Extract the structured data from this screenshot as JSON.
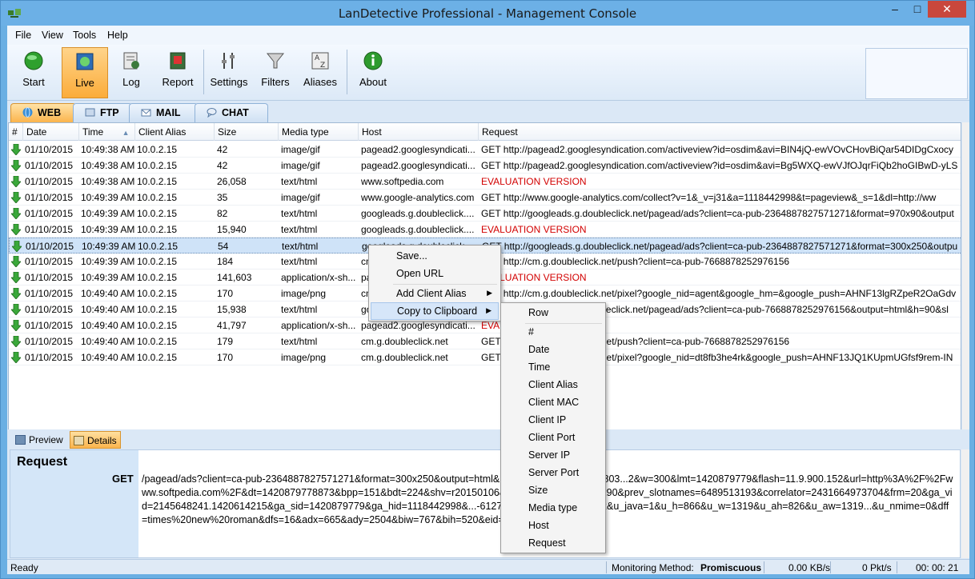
{
  "window": {
    "title": "LanDetective Professional - Management Console"
  },
  "menu": [
    "File",
    "View",
    "Tools",
    "Help"
  ],
  "toolbar": {
    "buttons": [
      {
        "label": "Start",
        "icon": "start-icon"
      },
      {
        "label": "Live",
        "icon": "live-icon",
        "active": true
      },
      {
        "label": "Log",
        "icon": "log-icon"
      },
      {
        "label": "Report",
        "icon": "report-icon"
      },
      {
        "label": "Settings",
        "icon": "settings-icon"
      },
      {
        "label": "Filters",
        "icon": "filter-icon"
      },
      {
        "label": "Aliases",
        "icon": "aliases-icon"
      },
      {
        "label": "About",
        "icon": "info-icon"
      }
    ]
  },
  "tabs": [
    {
      "label": "WEB",
      "active": true
    },
    {
      "label": "FTP"
    },
    {
      "label": "MAIL"
    },
    {
      "label": "CHAT"
    }
  ],
  "grid": {
    "columns": [
      "#",
      "Date",
      "Time",
      "Client Alias",
      "Size",
      "Media type",
      "Host",
      "Request"
    ],
    "rows": [
      {
        "date": "01/10/2015",
        "time": "10:49:38 AM",
        "client": "10.0.2.15",
        "size": "42",
        "media": "image/gif",
        "host": "pagead2.googlesyndicati...",
        "request": "GET http://pagead2.googlesyndication.com/activeview?id=osdim&avi=BIN4jQ-ewVOvCHovBiQar54DIDgCxocy",
        "eval": false
      },
      {
        "date": "01/10/2015",
        "time": "10:49:38 AM",
        "client": "10.0.2.15",
        "size": "42",
        "media": "image/gif",
        "host": "pagead2.googlesyndicati...",
        "request": "GET http://pagead2.googlesyndication.com/activeview?id=osdim&avi=Bg5WXQ-ewVJfOJqrFiQb2hoGIBwD-yLS",
        "eval": false
      },
      {
        "date": "01/10/2015",
        "time": "10:49:38 AM",
        "client": "10.0.2.15",
        "size": "26,058",
        "media": "text/html",
        "host": "www.softpedia.com",
        "request": "EVALUATION VERSION",
        "eval": true
      },
      {
        "date": "01/10/2015",
        "time": "10:49:39 AM",
        "client": "10.0.2.15",
        "size": "35",
        "media": "image/gif",
        "host": "www.google-analytics.com",
        "request": "GET http://www.google-analytics.com/collect?v=1&_v=j31&a=1118442998&t=pageview&_s=1&dl=http://ww",
        "eval": false
      },
      {
        "date": "01/10/2015",
        "time": "10:49:39 AM",
        "client": "10.0.2.15",
        "size": "82",
        "media": "text/html",
        "host": "googleads.g.doubleclick....",
        "request": "GET http://googleads.g.doubleclick.net/pagead/ads?client=ca-pub-2364887827571271&format=970x90&output",
        "eval": false
      },
      {
        "date": "01/10/2015",
        "time": "10:49:39 AM",
        "client": "10.0.2.15",
        "size": "15,940",
        "media": "text/html",
        "host": "googleads.g.doubleclick....",
        "request": "EVALUATION VERSION",
        "eval": true
      },
      {
        "date": "01/10/2015",
        "time": "10:49:39 AM",
        "client": "10.0.2.15",
        "size": "54",
        "media": "text/html",
        "host": "googleads.g.doubleclick....",
        "request": "GET http://googleads.g.doubleclick.net/pagead/ads?client=ca-pub-2364887827571271&format=300x250&outpu",
        "eval": false,
        "selected": true
      },
      {
        "date": "01/10/2015",
        "time": "10:49:39 AM",
        "client": "10.0.2.15",
        "size": "184",
        "media": "text/html",
        "host": "cm.g.doubleclick.net",
        "request": "GET http://cm.g.doubleclick.net/push?client=ca-pub-7668878252976156",
        "eval": false
      },
      {
        "date": "01/10/2015",
        "time": "10:49:39 AM",
        "client": "10.0.2.15",
        "size": "141,603",
        "media": "application/x-sh...",
        "host": "pagead2.googlesyndicati...",
        "request": "EVALUATION VERSION",
        "eval": true
      },
      {
        "date": "01/10/2015",
        "time": "10:49:40 AM",
        "client": "10.0.2.15",
        "size": "170",
        "media": "image/png",
        "host": "cm.g.doubleclick.net",
        "request": "GET http://cm.g.doubleclick.net/pixel?google_nid=agent&google_hm=&google_push=AHNF13lgRZpeR2OaGdv",
        "eval": false
      },
      {
        "date": "01/10/2015",
        "time": "10:49:40 AM",
        "client": "10.0.2.15",
        "size": "15,938",
        "media": "text/html",
        "host": "googleads.g.doubleclick....",
        "request": "GET http://googleads.g.doubleclick.net/pagead/ads?client=ca-pub-7668878252976156&output=html&h=90&sl",
        "eval": false
      },
      {
        "date": "01/10/2015",
        "time": "10:49:40 AM",
        "client": "10.0.2.15",
        "size": "41,797",
        "media": "application/x-sh...",
        "host": "pagead2.googlesyndicati...",
        "request": "EVALUATION VERSION",
        "eval": true
      },
      {
        "date": "01/10/2015",
        "time": "10:49:40 AM",
        "client": "10.0.2.15",
        "size": "179",
        "media": "text/html",
        "host": "cm.g.doubleclick.net",
        "request": "GET http://cm.g.doubleclick.net/push?client=ca-pub-7668878252976156",
        "eval": false
      },
      {
        "date": "01/10/2015",
        "time": "10:49:40 AM",
        "client": "10.0.2.15",
        "size": "170",
        "media": "image/png",
        "host": "cm.g.doubleclick.net",
        "request": "GET http://cm.g.doubleclick.net/pixel?google_nid=dt8fb3he4rk&google_push=AHNF13JQ1KUpmUGfsf9rem-IN",
        "eval": false
      }
    ]
  },
  "bottom_tabs": [
    {
      "label": "Preview"
    },
    {
      "label": "Details",
      "active": true
    }
  ],
  "details": {
    "title": "Request",
    "method": "GET",
    "text": "/pagead/ads?client=ca-pub-2364887827571271&format=300x250&output=html&h=250&slotname=9047803...2&w=300&lmt=1420879779&flash=11.9.900.152&url=http%3A%2F%2Fwww.softpedia.com%2F&dt=1420879778873&bpp=151&bdt=224&shv=r20150106&cbv=r20141212&...70x90&prev_slotnames=6489513193&correlator=2431664973704&frm=20&ga_vid=2145648241.1420614215&ga_sid=1420879779&ga_hid=1118442998&...-61277-1&u_tz=120&u_his=2&u_java=1&u_h=866&u_w=1319&u_ah=826&u_aw=1319...&u_nmime=0&dff=times%20new%20roman&dfs=16&adx=665&ady=2504&biw=767&bih=520&eid=317150304%2..."
  },
  "status": {
    "left": "Ready",
    "method_label": "Monitoring Method:",
    "method_value": "Promiscuous",
    "rate": "0.00 KB/s",
    "pkts": "0 Pkt/s",
    "time": "00: 00: 21"
  },
  "context_menu": {
    "items": [
      "Save...",
      "Open URL",
      "Add Client Alias",
      "Copy to Clipboard"
    ],
    "highlighted": "Copy to Clipboard"
  },
  "submenu": {
    "items": [
      "Row",
      "#",
      "Date",
      "Time",
      "Client Alias",
      "Client MAC",
      "Client IP",
      "Client Port",
      "Server IP",
      "Server Port",
      "Size",
      "Media type",
      "Host",
      "Request"
    ]
  }
}
